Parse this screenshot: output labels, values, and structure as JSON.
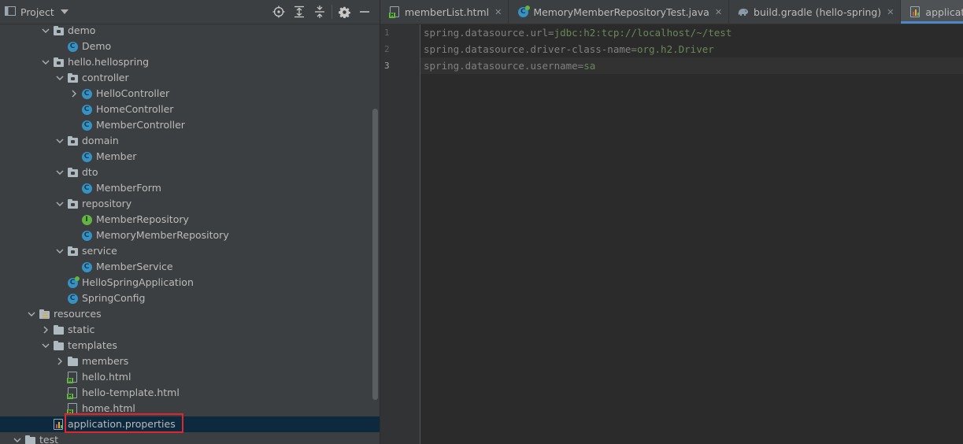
{
  "project_panel": {
    "title": "Project",
    "actions": [
      "locate-icon",
      "expand-all-icon",
      "collapse-all-icon",
      "settings-gear-icon",
      "hide-minus-icon"
    ]
  },
  "tree": [
    {
      "label": "demo",
      "type": "package",
      "depth": 4,
      "expanded": true
    },
    {
      "label": "Demo",
      "type": "class",
      "depth": 5
    },
    {
      "label": "hello.hellospring",
      "type": "package",
      "depth": 4,
      "expanded": true
    },
    {
      "label": "controller",
      "type": "package",
      "depth": 5,
      "expanded": true
    },
    {
      "label": "HelloController",
      "type": "class",
      "depth": 6,
      "collapsed": true
    },
    {
      "label": "HomeController",
      "type": "class",
      "depth": 6
    },
    {
      "label": "MemberController",
      "type": "class",
      "depth": 6
    },
    {
      "label": "domain",
      "type": "package",
      "depth": 5,
      "expanded": true
    },
    {
      "label": "Member",
      "type": "class",
      "depth": 6
    },
    {
      "label": "dto",
      "type": "package",
      "depth": 5,
      "expanded": true
    },
    {
      "label": "MemberForm",
      "type": "class",
      "depth": 6
    },
    {
      "label": "repository",
      "type": "package",
      "depth": 5,
      "expanded": true
    },
    {
      "label": "MemberRepository",
      "type": "interface",
      "depth": 6
    },
    {
      "label": "MemoryMemberRepository",
      "type": "class",
      "depth": 6
    },
    {
      "label": "service",
      "type": "package",
      "depth": 5,
      "expanded": true
    },
    {
      "label": "MemberService",
      "type": "class",
      "depth": 6
    },
    {
      "label": "HelloSpringApplication",
      "type": "app",
      "depth": 5
    },
    {
      "label": "SpringConfig",
      "type": "class",
      "depth": 5
    },
    {
      "label": "resources",
      "type": "resources",
      "depth": 3,
      "expanded": true
    },
    {
      "label": "static",
      "type": "folder",
      "depth": 4,
      "collapsed": true
    },
    {
      "label": "templates",
      "type": "folder",
      "depth": 4,
      "expanded": true
    },
    {
      "label": "members",
      "type": "folder",
      "depth": 5,
      "collapsed": true
    },
    {
      "label": "hello.html",
      "type": "html",
      "depth": 5
    },
    {
      "label": "hello-template.html",
      "type": "html",
      "depth": 5
    },
    {
      "label": "home.html",
      "type": "html",
      "depth": 5
    },
    {
      "label": "application.properties",
      "type": "properties",
      "depth": 4,
      "selected": true
    },
    {
      "label": "test",
      "type": "folder",
      "depth": 2,
      "expanded": true
    }
  ],
  "tabs": [
    {
      "label": "memberList.html",
      "icon": "html-file-icon",
      "active": false
    },
    {
      "label": "MemoryMemberRepositoryTest.java",
      "icon": "java-test-class-icon",
      "active": false
    },
    {
      "label": "build.gradle (hello-spring)",
      "icon": "gradle-elephant-icon",
      "active": false
    },
    {
      "label": "application.properties",
      "icon": "properties-file-icon",
      "active": true
    }
  ],
  "editor": {
    "current_line": 3,
    "lines": [
      {
        "number": "1",
        "key": "spring.datasource.url",
        "sep": "=",
        "value": "jdbc:h2:tcp://localhost/~/test"
      },
      {
        "number": "2",
        "key": "spring.datasource.driver-class-name",
        "sep": "=",
        "value": "org.h2.Driver"
      },
      {
        "number": "3",
        "key": "spring.datasource.username",
        "sep": "=",
        "value": "sa"
      }
    ]
  },
  "colors": {
    "panel_bg": "#3c3f41",
    "editor_bg": "#2b2b2b",
    "selection": "#0d293e",
    "accent": "#4a88c7",
    "highlight_box": "#e0262a",
    "property_key": "#808080",
    "property_value": "#6a8759"
  }
}
